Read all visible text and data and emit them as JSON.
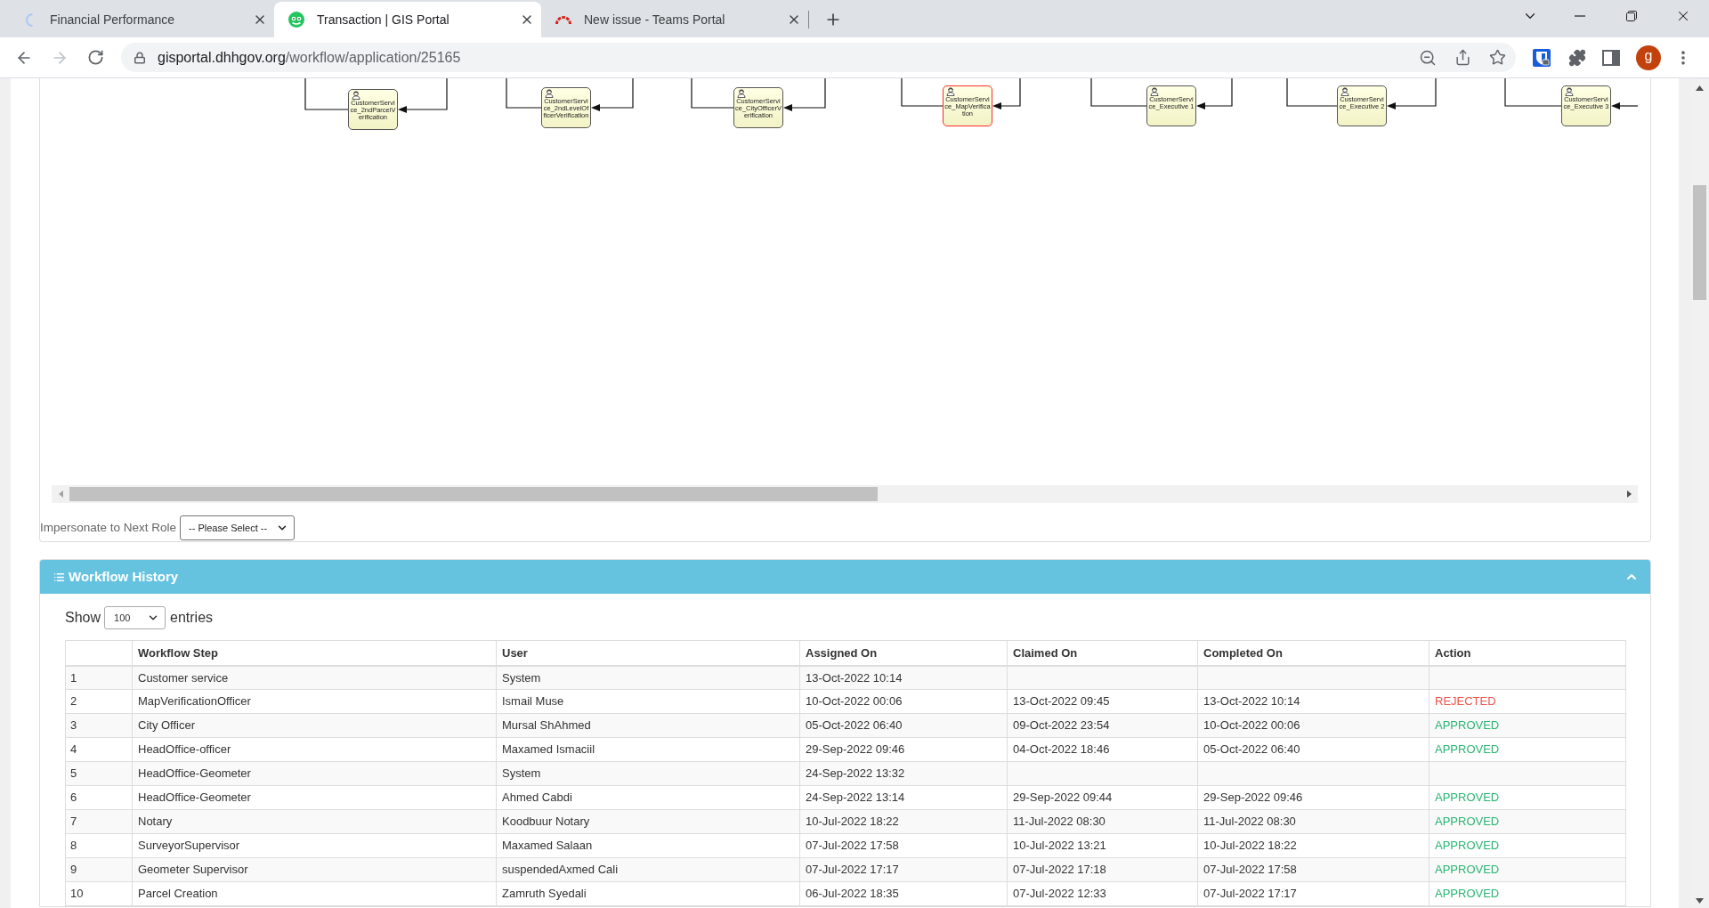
{
  "browser": {
    "tabs": [
      {
        "title": "Financial Performance",
        "kind": "loading",
        "selected": false
      },
      {
        "title": "Transaction | GIS Portal",
        "kind": "portal",
        "selected": true
      },
      {
        "title": "New issue - Teams Portal",
        "kind": "tracker",
        "selected": false
      }
    ],
    "forward_disabled": true,
    "url": {
      "host": "gisportal.dhhgov.org",
      "path": "/workflow/application/25165"
    },
    "profile": {
      "initial": "g"
    }
  },
  "diagram": {
    "nodes": [
      {
        "label": "CustomerService_2ndParcelVerification",
        "current": false
      },
      {
        "label": "CustomerService_2ndLevelOfficerVerification",
        "current": false
      },
      {
        "label": "CustomerService_CityOfficerVerification",
        "current": false
      },
      {
        "label": "CustomerService_MapVerification",
        "current": true
      },
      {
        "label": "CustomerService_Executive 1",
        "current": false
      },
      {
        "label": "CustomerService_Executive 2",
        "current": false
      },
      {
        "label": "CustomerService_Executive 3",
        "current": false
      }
    ]
  },
  "impersonate": {
    "label": "Impersonate to Next Role",
    "select": {
      "value": "-- Please Select --"
    }
  },
  "workflow_history": {
    "title": "Workflow History",
    "expanded": true,
    "length_menu": {
      "label_before": "Show",
      "value": "100",
      "label_after": "entries"
    },
    "table": {
      "columns": [
        "Workflow Step",
        "User",
        "Assigned On",
        "Claimed On",
        "Completed On",
        "Action"
      ],
      "rows": [
        {
          "number": "1",
          "step": "Customer service",
          "user": "System",
          "assigned_on": "13-Oct-2022 10:14"
        },
        {
          "number": "2",
          "step": "MapVerificationOfficer",
          "user": "Ismail Muse",
          "assigned_on": "10-Oct-2022 00:06",
          "claimed_on": "13-Oct-2022 09:45",
          "completed_on": "13-Oct-2022 10:14",
          "action": {
            "label": "REJECTED",
            "kind": "rejected"
          }
        },
        {
          "number": "3",
          "step": "City Officer",
          "user": "Mursal ShAhmed",
          "assigned_on": "05-Oct-2022 06:40",
          "claimed_on": "09-Oct-2022 23:54",
          "completed_on": "10-Oct-2022 00:06",
          "action": {
            "label": "APPROVED",
            "kind": "approved"
          }
        },
        {
          "number": "4",
          "step": "HeadOffice-officer",
          "user": "Maxamed Ismaciil",
          "assigned_on": "29-Sep-2022 09:46",
          "claimed_on": "04-Oct-2022 18:46",
          "completed_on": "05-Oct-2022 06:40",
          "action": {
            "label": "APPROVED",
            "kind": "approved"
          }
        },
        {
          "number": "5",
          "step": "HeadOffice-Geometer",
          "user": "System",
          "assigned_on": "24-Sep-2022 13:32"
        },
        {
          "number": "6",
          "step": "HeadOffice-Geometer",
          "user": "Ahmed Cabdi",
          "assigned_on": "24-Sep-2022 13:14",
          "claimed_on": "29-Sep-2022 09:44",
          "completed_on": "29-Sep-2022 09:46",
          "action": {
            "label": "APPROVED",
            "kind": "approved"
          }
        },
        {
          "number": "7",
          "step": "Notary",
          "user": "Koodbuur Notary",
          "assigned_on": "10-Jul-2022 18:22",
          "claimed_on": "11-Jul-2022 08:30",
          "completed_on": "11-Jul-2022 08:30",
          "action": {
            "label": "APPROVED",
            "kind": "approved"
          }
        },
        {
          "number": "8",
          "step": "SurveyorSupervisor",
          "user": "Maxamed Salaan",
          "assigned_on": "07-Jul-2022 17:58",
          "claimed_on": "10-Jul-2022 13:21",
          "completed_on": "10-Jul-2022 18:22",
          "action": {
            "label": "APPROVED",
            "kind": "approved"
          }
        },
        {
          "number": "9",
          "step": "Geometer Supervisor",
          "user": "suspendedAxmed Cali",
          "assigned_on": "07-Jul-2022 17:17",
          "claimed_on": "07-Jul-2022 17:18",
          "completed_on": "07-Jul-2022 17:58",
          "action": {
            "label": "APPROVED",
            "kind": "approved"
          }
        },
        {
          "number": "10",
          "step": "Parcel Creation",
          "user": "Zamruth Syedali",
          "assigned_on": "06-Jul-2022 18:35",
          "claimed_on": "07-Jul-2022 12:33",
          "completed_on": "07-Jul-2022 17:17",
          "action": {
            "label": "APPROVED",
            "kind": "approved"
          }
        }
      ]
    }
  }
}
